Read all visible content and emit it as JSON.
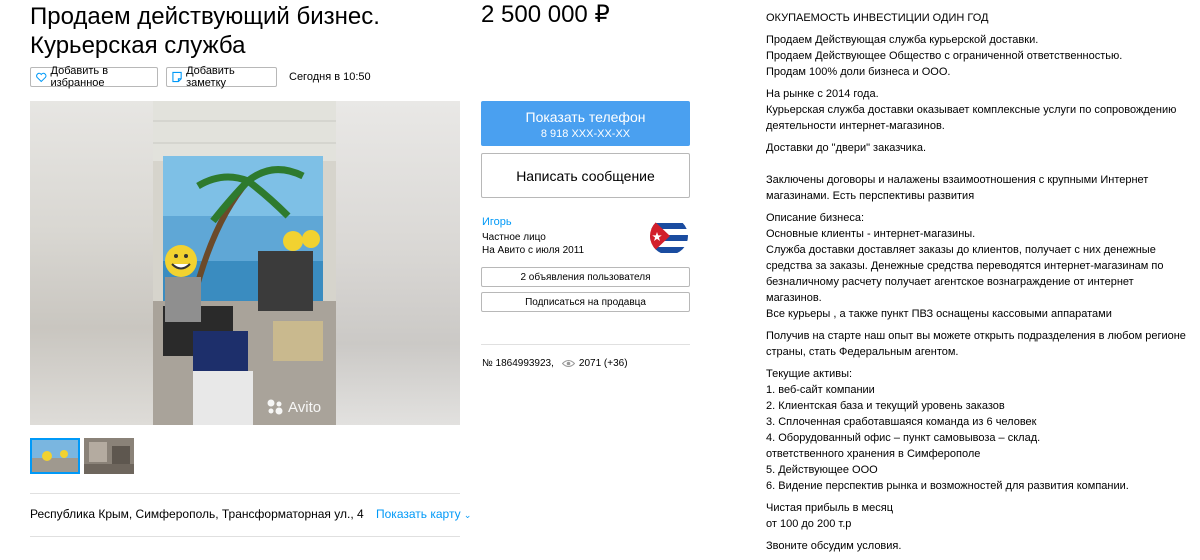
{
  "listing": {
    "title": "Продаем действующий бизнес. Курьерская служба",
    "price": "2 500 000 ₽"
  },
  "actions": {
    "favorite_label": "Добавить в избранное",
    "note_label": "Добавить заметку",
    "posted": "Сегодня в 10:50"
  },
  "gallery": {
    "watermark": "Avito"
  },
  "contact": {
    "phone_button_label": "Показать телефон",
    "phone_masked": "8 918 XXX-XX-XX",
    "message_button_label": "Написать сообщение"
  },
  "seller": {
    "name": "Игорь",
    "type": "Частное лицо",
    "since": "На Авито с июля 2011",
    "listings_button": "2 объявления пользователя",
    "subscribe_button": "Подписаться на продавца"
  },
  "meta": {
    "ad_number": "№ 1864993923,",
    "views": "2071 (+36)"
  },
  "location": {
    "address": "Республика Крым, Симферополь, Трансформаторная ул., 4",
    "map_link": "Показать карту"
  },
  "description": {
    "paragraphs": [
      [
        "ОКУПАЕМОСТЬ ИНВЕСТИЦИИ ОДИН ГОД"
      ],
      [
        "Продаем Действующая служба курьерской доставки.",
        "Продаем Действующее Общество с ограниченной ответственностью.",
        "Продам 100% доли бизнеса и ООО."
      ],
      [
        "На рынке с 2014 года.",
        "Курьерская служба доставки оказывает комплексные услуги по сопровождению",
        "деятельности интернет-магазинов."
      ],
      [
        "Доставки до \"двери\" заказчика."
      ],
      [
        "",
        "Заключены договоры и налажены взаимоотношения с крупными Интернет",
        "магазинами. Есть перспективы развития"
      ],
      [
        "Описание бизнеса:",
        "Основные клиенты - интернет-магазины.",
        "Служба доставки доставляет заказы до клиентов, получает с них денежные",
        "средства за заказы. Денежные средства переводятся интернет-магазинам по",
        "безналичному расчету получает агентское вознаграждение от интернет магазинов.",
        "Все курьеры , а также пункт ПВЗ оснащены кассовыми аппаратами"
      ],
      [
        "Получив на старте наш опыт вы можете открыть подразделения в любом регионе",
        "страны, стать Федеральным агентом."
      ],
      [
        "Текущие активы:",
        "1. веб-сайт компании",
        "2. Клиентская база и текущий уровень заказов",
        "3. Сплоченная сработавшаяся команда из 6 человек",
        "4. Оборудованный офис – пункт самовывоза – склад.",
        "ответственного хранения в Симферополе",
        "5. Действующее ООО",
        "6. Видение перспектив рынка и возможностей для развития компании."
      ],
      [
        "Чистая прибыль в месяц",
        "от 100 до 200 т.р"
      ],
      [
        "Звоните обсудим условия."
      ]
    ]
  },
  "colors": {
    "accent": "#0099f7",
    "phone_button": "#4aa0f0"
  }
}
